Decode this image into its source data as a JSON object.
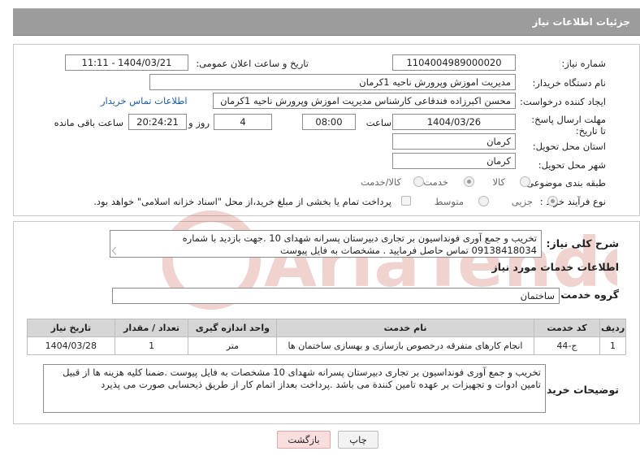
{
  "header": {
    "title": "جزئیات اطلاعات نیاز"
  },
  "form": {
    "need_number_label": "شماره نیاز:",
    "need_number": "1104004989000020",
    "announce_label": "تاریخ و ساعت اعلان عمومی:",
    "announce_value": "1404/03/21 - 11:11",
    "buyer_org_label": "نام دستگاه خریدار:",
    "buyer_org": "مدیریت اموزش وپرورش ناحیه 1کرمان",
    "creator_label": "ایجاد کننده درخواست:",
    "creator": "محسن اکبرزاده فندقاعی کارشناس  مدیریت اموزش وپرورش ناحیه 1کرمان",
    "contact_link": "اطلاعات تماس خریدار",
    "deadline_label": "مهلت ارسال پاسخ: تا تاریخ:",
    "deadline_date": "1404/03/26",
    "time_label": "ساعت",
    "deadline_time": "08:00",
    "days_value": "4",
    "days_label": "روز و",
    "remaining_time": "20:24:21",
    "remaining_label": "ساعت باقی مانده",
    "province_label": "استان محل تحویل:",
    "province": "کرمان",
    "city_label": "شهر محل تحویل:",
    "city": "کرمان",
    "category_label": "طبقه بندی موضوعی:",
    "category_options": [
      "کالا",
      "خدمت",
      "کالا/خدمت"
    ],
    "category_selected": "خدمت",
    "process_label": "نوع فرآیند خرید :",
    "process_options": [
      "جزیی",
      "متوسط"
    ],
    "process_selected": "جزیی",
    "payment_note": "پرداخت تمام یا بخشی از مبلغ خرید،از محل \"اسناد خزانه اسلامی\" خواهد بود."
  },
  "details": {
    "summary_label": "شرح کلی نیاز:",
    "summary": "تخریب و جمع آوری فونداسیون بر تجاری دبیرستان پسرانه شهدای 10 .جهت بازدید با شماره 09138418034 تماس حاصل فرمایید . مشخصات به فایل پیوست",
    "services_title": "اطلاعات خدمات مورد نیاز",
    "service_group_label": "گروه خدمت:",
    "service_group": "ساختمان",
    "table": {
      "headers": [
        "ردیف",
        "کد خدمت",
        "نام خدمت",
        "واحد اندازه گیری",
        "تعداد / مقدار",
        "تاریخ نیاز"
      ],
      "rows": [
        [
          "1",
          "ج-44",
          "انجام کارهای متفرقه درخصوص بازسازی و بهسازی ساختمان ها",
          "متر",
          "1",
          "1404/03/28"
        ]
      ]
    },
    "buyer_notes_label": "توضیحات خریدار:",
    "buyer_notes": "تخریب و جمع آوری فونداسیون بر تجاری دبیرستان پسرانه شهدای 10 مشخصات به فایل پیوست .ضمنا کلیه هزینه ها از قبیل تامین ادوات و تجهیزات بر عهده تامین کنندة می باشد .پرداخت بعداز اتمام کار از طریق ذیحسابی صورت می پذیرد"
  },
  "buttons": {
    "print": "چاپ",
    "back": "بازگشت"
  },
  "watermark_text": "AriaTender.neT",
  "colors": {
    "header_bg": "#9c9c9c",
    "link": "#1d5ea8",
    "back_button_bg": "#f9dede",
    "table_header_bg": "#d6d6d6",
    "watermark": "#c0392b"
  }
}
